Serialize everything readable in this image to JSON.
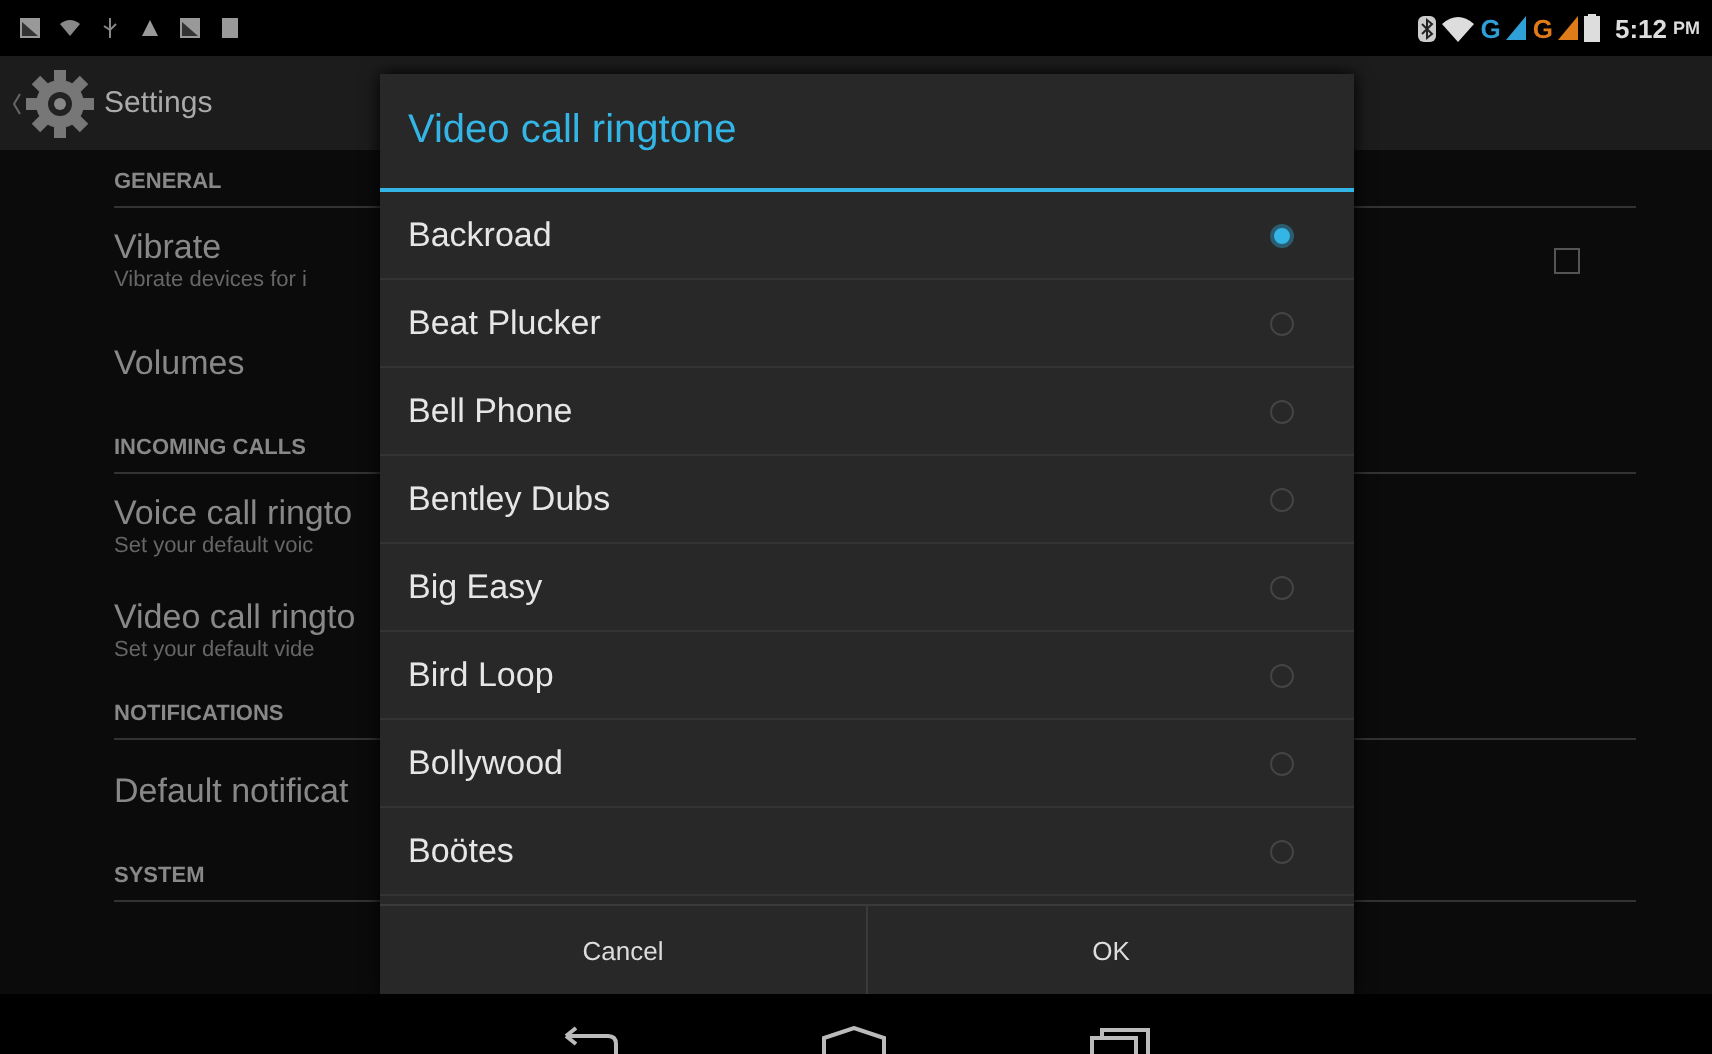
{
  "status_bar": {
    "networks": [
      {
        "label": "G",
        "color": "#2f9fd8"
      },
      {
        "label": "G",
        "color": "#e07b1a"
      }
    ],
    "time": "5:12",
    "ampm": "PM"
  },
  "action_bar": {
    "title": "Settings"
  },
  "settings": [
    {
      "kind": "header",
      "title": "GENERAL"
    },
    {
      "kind": "toggle",
      "title": "Vibrate",
      "summary": "Vibrate devices for i",
      "checked": false
    },
    {
      "kind": "item",
      "title": "Volumes"
    },
    {
      "kind": "header",
      "title": "INCOMING CALLS"
    },
    {
      "kind": "item",
      "title": "Voice call ringto",
      "summary": "Set your default voic"
    },
    {
      "kind": "item",
      "title": "Video call ringto",
      "summary": "Set your default vide"
    },
    {
      "kind": "header",
      "title": "NOTIFICATIONS"
    },
    {
      "kind": "item",
      "title": "Default notificat"
    },
    {
      "kind": "header",
      "title": "SYSTEM"
    }
  ],
  "dialog": {
    "title": "Video call ringtone",
    "options": [
      {
        "label": "Backroad",
        "selected": true
      },
      {
        "label": "Beat Plucker",
        "selected": false
      },
      {
        "label": "Bell Phone",
        "selected": false
      },
      {
        "label": "Bentley Dubs",
        "selected": false
      },
      {
        "label": "Big Easy",
        "selected": false
      },
      {
        "label": "Bird Loop",
        "selected": false
      },
      {
        "label": "Bollywood",
        "selected": false
      },
      {
        "label": "Boötes",
        "selected": false
      }
    ],
    "buttons": [
      "Cancel",
      "OK"
    ]
  }
}
